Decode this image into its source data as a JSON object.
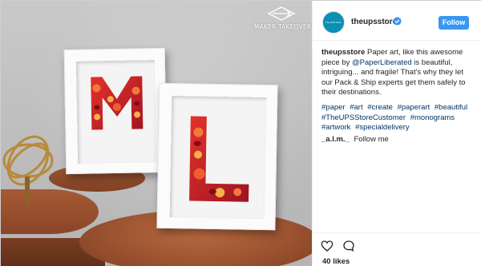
{
  "overlay": {
    "logo_text": "MAKER TAKEOVER"
  },
  "header": {
    "avatar_text": "The UPS Store",
    "username": "theupsstore",
    "follow_label": "Follow"
  },
  "caption": {
    "username": "theupsstore",
    "text_1": "Paper art, like this awesome piece by",
    "mention": "@PaperLiberated",
    "text_2": "is beautiful, intriguing... and fragile! That's why they let our Pack & Ship experts get them safely to their destinations."
  },
  "hashtags": [
    "#paper",
    "#art",
    "#create",
    "#paperart",
    "#beautiful",
    "#TheUPSStoreCustomer",
    "#monograms",
    "#artwork",
    "#specialdelivery"
  ],
  "comment": {
    "username": "_a.l.m._",
    "text": "Follow me"
  },
  "actions": {
    "likes": "40 likes"
  },
  "colors": {
    "accent": "#3897f0",
    "link": "#003569",
    "avatar": "#0a8fb5"
  }
}
